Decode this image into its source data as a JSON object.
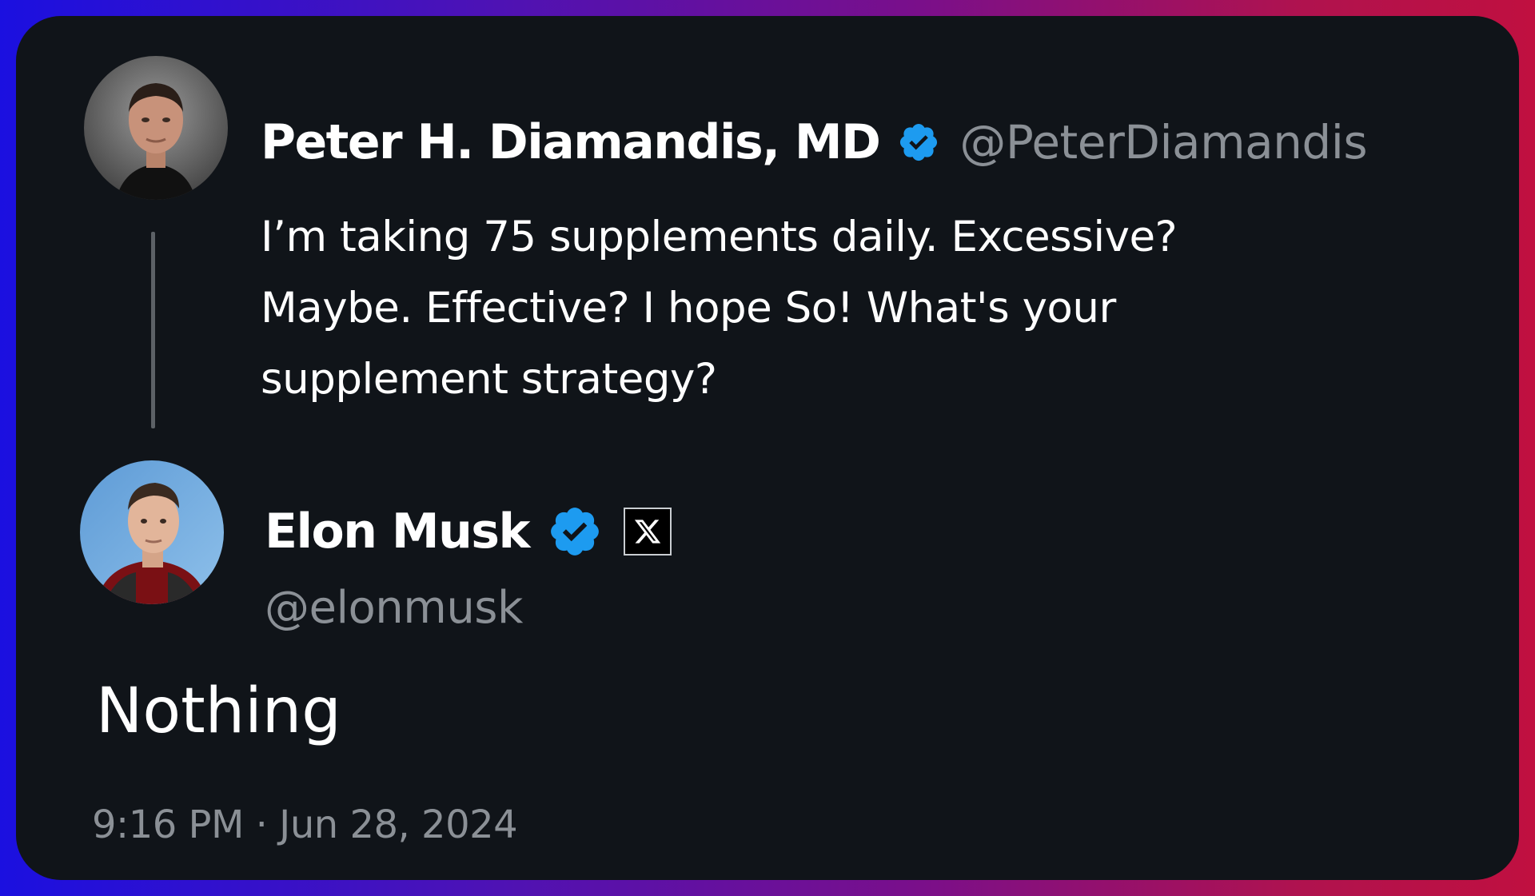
{
  "original_tweet": {
    "author_name": "Peter H. Diamandis, MD",
    "author_handle": "@PeterDiamandis",
    "verified": true,
    "text": "I’m taking 75 supplements daily. Excessive? Maybe. Effective? I hope So! What's your supplement strategy?"
  },
  "reply": {
    "author_name": "Elon Musk",
    "author_handle": "@elonmusk",
    "verified": true,
    "affiliate_icon": "x-logo-icon",
    "text": "Nothing",
    "timestamp": "9:16 PM · Jun 28, 2024"
  },
  "colors": {
    "card_background": "#101419",
    "verified_badge": "#1d9bf0",
    "handle_text": "#8b9096",
    "primary_text": "#ffffff",
    "thread_line": "#5c6166",
    "border_gradient_left": "#1b10e0",
    "border_gradient_right": "#c01040"
  }
}
